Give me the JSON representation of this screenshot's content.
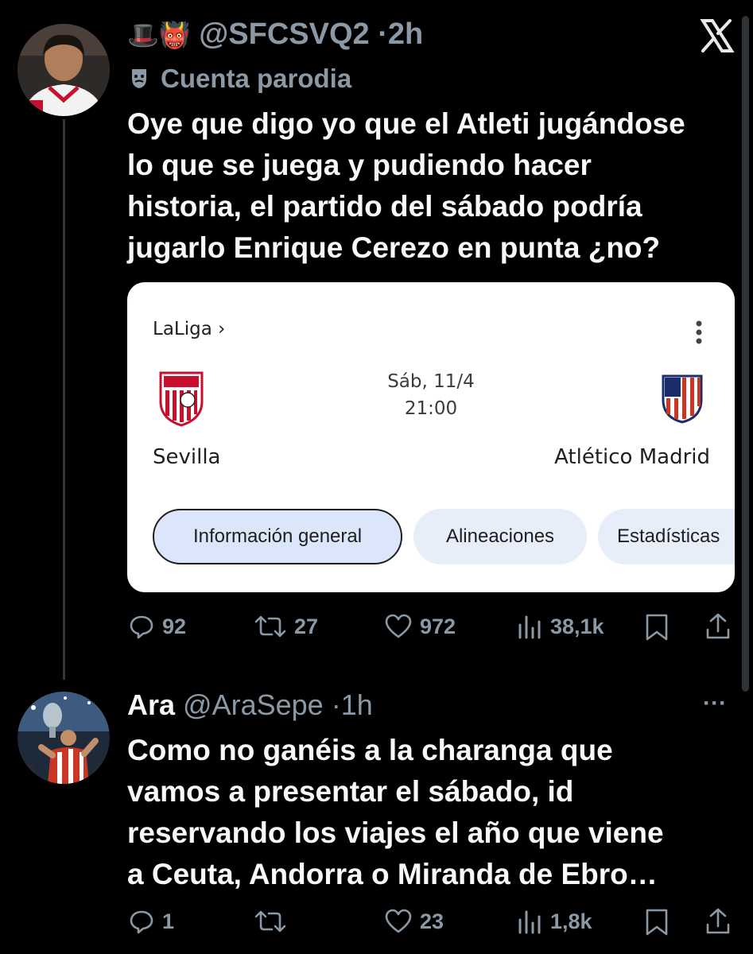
{
  "tweet1": {
    "emoji": "🎩👹",
    "handle": "@SFCSVQ2",
    "dot": "·",
    "time": "2h",
    "parody_icon": "theater-masks-icon",
    "parody_label": "Cuenta parodia",
    "lines": [
      "Oye que digo yo que el Atleti jugándose",
      "lo que se juega y pudiendo hacer",
      "historia, el partido del sábado podría",
      "jugarlo Enrique Cerezo en punta ¿no?"
    ],
    "card": {
      "league": "LaLiga ›",
      "date": "Sáb, 11/4",
      "time": "21:00",
      "home_team": "Sevilla",
      "away_team": "Atlético Madrid",
      "tabs": [
        "Información general",
        "Alineaciones",
        "Estadísticas"
      ]
    },
    "stats": {
      "replies": "92",
      "retweets": "27",
      "likes": "972",
      "views": "38,1k"
    }
  },
  "tweet2": {
    "name": "Ara",
    "handle": "@AraSepe",
    "dot": "·",
    "time": "1h",
    "more": "···",
    "lines": [
      "Como no ganéis a la charanga que",
      "vamos a presentar el sábado, id",
      "reservando los viajes el año que viene",
      "a Ceuta, Andorra o Miranda de Ebro…"
    ],
    "stats": {
      "replies": "1",
      "retweets": "",
      "likes": "23",
      "views": "1,8k"
    }
  },
  "x_logo": "𝕏",
  "colors": {
    "background": "#000000",
    "text": "#e7e9ea",
    "muted": "#8b98a5",
    "chip_active": "#dbe6fb",
    "chip_inactive": "#e8eef9"
  }
}
